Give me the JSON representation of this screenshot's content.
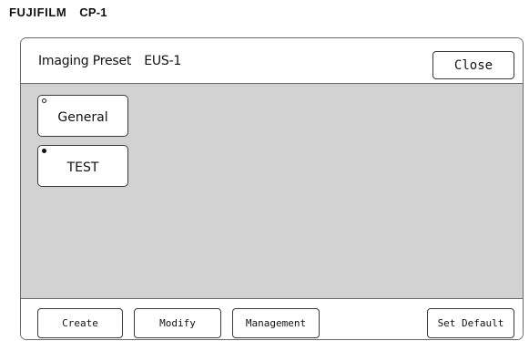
{
  "brand": {
    "logo_text": "FUJIFILM",
    "model": "CP-1"
  },
  "header": {
    "title": "Imaging Preset",
    "preset_name": "EUS-1",
    "close_label": "Close"
  },
  "presets": [
    {
      "label": "General",
      "indicator": "empty"
    },
    {
      "label": "TEST",
      "indicator": "filled"
    }
  ],
  "footer": {
    "create_label": "Create",
    "modify_label": "Modify",
    "management_label": "Management",
    "set_default_label": "Set Default"
  },
  "colors": {
    "content_background": "#d2d2d2",
    "border": "#6a6a6a"
  }
}
